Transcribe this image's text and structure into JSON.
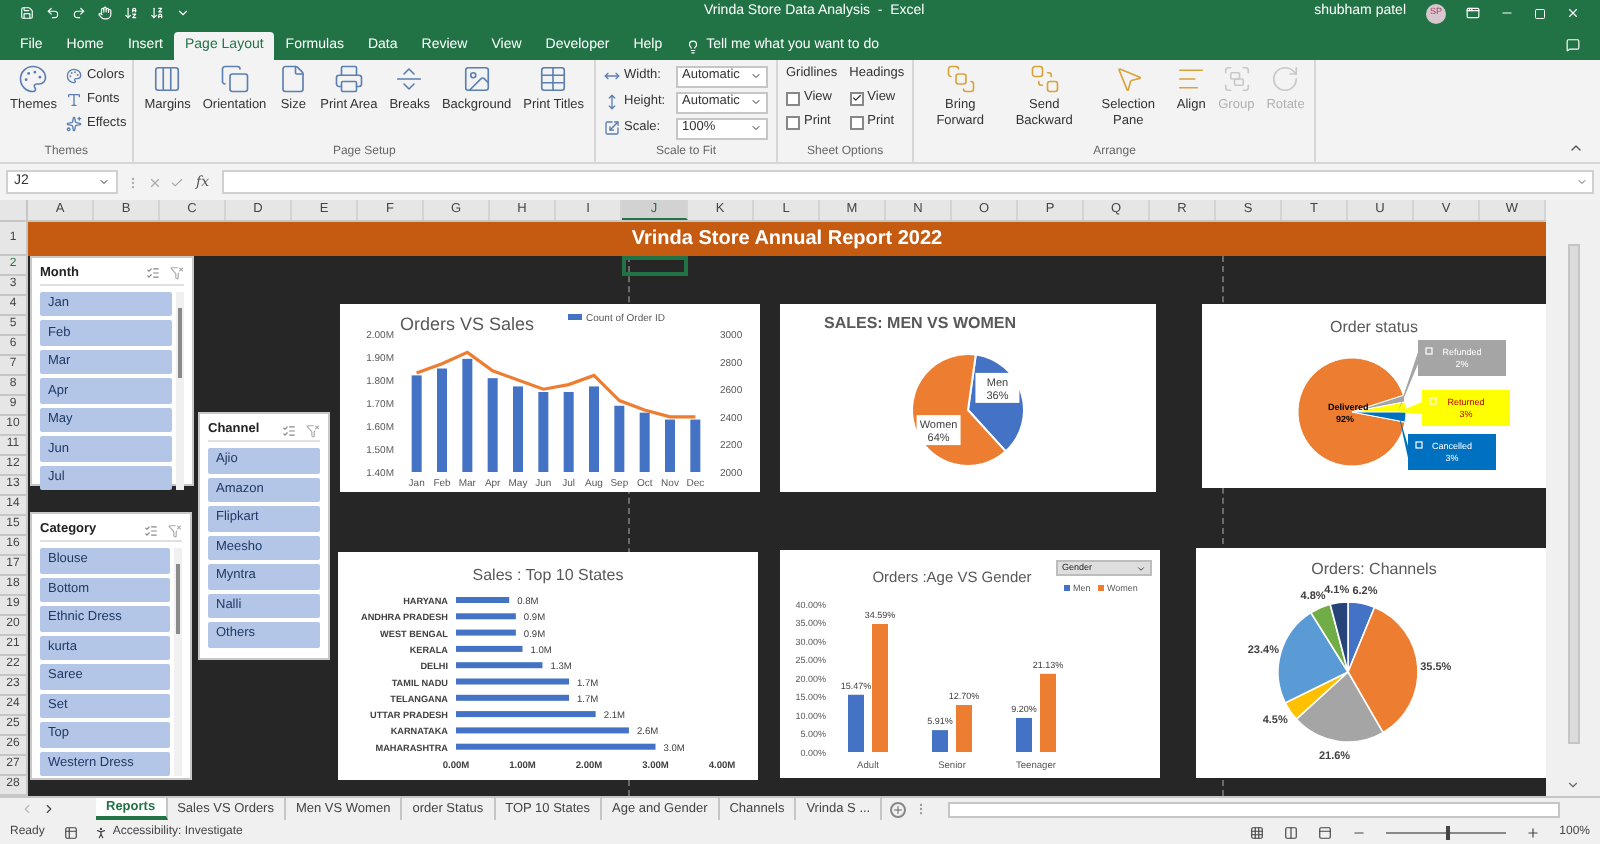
{
  "window": {
    "title": "Vrinda Store Data Analysis  -  Excel",
    "user": "shubham patel",
    "user_initials": "SP"
  },
  "menu_tabs": [
    {
      "label": "File",
      "selected": false
    },
    {
      "label": "Home",
      "selected": false
    },
    {
      "label": "Insert",
      "selected": false
    },
    {
      "label": "Page Layout",
      "selected": true
    },
    {
      "label": "Formulas",
      "selected": false
    },
    {
      "label": "Data",
      "selected": false
    },
    {
      "label": "Review",
      "selected": false
    },
    {
      "label": "View",
      "selected": false
    },
    {
      "label": "Developer",
      "selected": false
    },
    {
      "label": "Help",
      "selected": false
    }
  ],
  "tell_me": "Tell me what you want to do",
  "ribbon": {
    "themes": {
      "label": "Themes",
      "big": "Themes",
      "small": [
        "Colors",
        "Fonts",
        "Effects"
      ]
    },
    "page_setup": {
      "label": "Page Setup",
      "buttons": [
        "Margins",
        "Orientation",
        "Size",
        "Print Area",
        "Breaks",
        "Background",
        "Print Titles"
      ]
    },
    "scale_to_fit": {
      "label": "Scale to Fit",
      "rows": [
        {
          "label": "Width:",
          "value": "Automatic"
        },
        {
          "label": "Height:",
          "value": "Automatic"
        },
        {
          "label": "Scale:",
          "value": "100%"
        }
      ]
    },
    "sheet_options": {
      "label": "Sheet Options",
      "columns": [
        {
          "heading": "Gridlines",
          "options": [
            {
              "label": "View",
              "checked": false
            },
            {
              "label": "Print",
              "checked": false
            }
          ]
        },
        {
          "heading": "Headings",
          "options": [
            {
              "label": "View",
              "checked": true
            },
            {
              "label": "Print",
              "checked": false
            }
          ]
        }
      ]
    },
    "arrange": {
      "label": "Arrange",
      "buttons": [
        {
          "label": "Bring Forward",
          "disabled": false
        },
        {
          "label": "Send Backward",
          "disabled": false
        },
        {
          "label": "Selection Pane",
          "disabled": false
        },
        {
          "label": "Align",
          "disabled": false
        },
        {
          "label": "Group",
          "disabled": true
        },
        {
          "label": "Rotate",
          "disabled": true
        }
      ]
    }
  },
  "formula_bar": {
    "name_box": "J2",
    "function_label": "fx"
  },
  "columns": [
    "A",
    "B",
    "C",
    "D",
    "E",
    "F",
    "G",
    "H",
    "I",
    "J",
    "K",
    "L",
    "M",
    "N",
    "O",
    "P",
    "Q",
    "R",
    "S",
    "T",
    "U",
    "V",
    "W"
  ],
  "rows": [
    "1",
    "2",
    "3",
    "4",
    "5",
    "6",
    "7",
    "8",
    "9",
    "10",
    "11",
    "12",
    "13",
    "14",
    "15",
    "16",
    "17",
    "18",
    "19",
    "20",
    "21",
    "22",
    "23",
    "24",
    "25",
    "26",
    "27",
    "28"
  ],
  "report_title": "Vrinda Store Annual Report 2022",
  "slicers": [
    {
      "title": "Month",
      "items": [
        {
          "label": "Jan",
          "selected": true
        },
        {
          "label": "Feb",
          "selected": true
        },
        {
          "label": "Mar",
          "selected": true
        },
        {
          "label": "Apr",
          "selected": true
        },
        {
          "label": "May",
          "selected": true
        },
        {
          "label": "Jun",
          "selected": true
        },
        {
          "label": "Jul",
          "selected": true
        }
      ]
    },
    {
      "title": "Category",
      "items": [
        {
          "label": "Blouse",
          "selected": true
        },
        {
          "label": "Bottom",
          "selected": true
        },
        {
          "label": "Ethnic Dress",
          "selected": true
        },
        {
          "label": "kurta",
          "selected": true
        },
        {
          "label": "Saree",
          "selected": true
        },
        {
          "label": "Set",
          "selected": true
        },
        {
          "label": "Top",
          "selected": true
        },
        {
          "label": "Western Dress",
          "selected": true
        }
      ]
    },
    {
      "title": "Channel",
      "items": [
        {
          "label": "Ajio",
          "selected": true
        },
        {
          "label": "Amazon",
          "selected": true
        },
        {
          "label": "Flipkart",
          "selected": true
        },
        {
          "label": "Meesho",
          "selected": true
        },
        {
          "label": "Myntra",
          "selected": true
        },
        {
          "label": "Nalli",
          "selected": true
        },
        {
          "label": "Others",
          "selected": true
        }
      ]
    }
  ],
  "charts": [
    {
      "kind": "combo",
      "chart_data": {
        "type": "bar",
        "title": "Orders VS Sales",
        "categories": [
          "Jan",
          "Feb",
          "Mar",
          "Apr",
          "May",
          "Jun",
          "Jul",
          "Aug",
          "Sep",
          "Oct",
          "Nov",
          "Dec"
        ],
        "legend": "top",
        "series": [
          {
            "name": "Count of Order ID",
            "color": "#4472c4",
            "axis": "y2",
            "values": [
              2700,
              2750,
              2820,
              2680,
              2620,
              2580,
              2580,
              2620,
              2480,
              2430,
              2380,
              2380
            ]
          },
          {
            "type": "line",
            "color": "#ed7d31",
            "values": [
              1.83,
              1.87,
              1.92,
              1.84,
              1.8,
              1.76,
              1.78,
              1.82,
              1.71,
              1.67,
              1.64,
              1.64
            ]
          }
        ],
        "ylim": [
          1.4,
          2.0
        ],
        "yticks": [
          {
            "value": 1.4,
            "label": "1.40M"
          },
          {
            "value": 1.5,
            "label": "1.50M"
          },
          {
            "value": 1.6,
            "label": "1.60M"
          },
          {
            "value": 1.7,
            "label": "1.70M"
          },
          {
            "value": 1.8,
            "label": "1.80M"
          },
          {
            "value": 1.9,
            "label": "1.90M"
          },
          {
            "value": 2.0,
            "label": "2.00M"
          }
        ],
        "y2lim": [
          2000,
          3000
        ],
        "y2ticks": [
          2000,
          2200,
          2400,
          2600,
          2800,
          3000
        ]
      }
    },
    {
      "kind": "pie_labeled",
      "chart_data": {
        "type": "pie",
        "title": "SALES: MEN VS WOMEN",
        "categories": [
          "Men",
          "Women"
        ],
        "values": [
          36,
          64
        ],
        "colors": [
          "#4472c4",
          "#ed7d31"
        ],
        "value_labels": [
          "36%",
          "64%"
        ]
      }
    },
    {
      "kind": "pie_callout",
      "chart_data": {
        "type": "pie",
        "title": "Order status",
        "legend": "right",
        "categories": [
          "Delivered",
          "Refunded",
          "Returned",
          "Cancelled"
        ],
        "values": [
          92,
          2,
          3,
          3
        ],
        "colors": [
          "#ed7d31",
          "#a5a5a5",
          "#ffff00",
          "#0070c0"
        ],
        "value_labels": [
          "92%",
          "2%",
          "3%",
          "3%"
        ]
      }
    },
    {
      "kind": "hbar",
      "chart_data": {
        "type": "bar",
        "orientation": "horizontal",
        "title": "Sales : Top 10 States",
        "categories": [
          "HARYANA",
          "ANDHRA PRADESH",
          "WEST BENGAL",
          "KERALA",
          "DELHI",
          "TAMIL NADU",
          "TELANGANA",
          "UTTAR PRADESH",
          "KARNATAKA",
          "MAHARASHTRA"
        ],
        "series": [
          {
            "color": "#4472c4",
            "values": [
              0.8,
              0.9,
              0.9,
              1.0,
              1.3,
              1.7,
              1.7,
              2.1,
              2.6,
              3.0
            ]
          }
        ],
        "value_labels": [
          "0.8M",
          "0.9M",
          "0.9M",
          "1.0M",
          "1.3M",
          "1.7M",
          "1.7M",
          "2.1M",
          "2.6M",
          "3.0M"
        ],
        "xlim": [
          0,
          4
        ],
        "xticks": [
          {
            "value": 0,
            "label": "0.00M"
          },
          {
            "value": 1,
            "label": "1.00M"
          },
          {
            "value": 2,
            "label": "2.00M"
          },
          {
            "value": 3,
            "label": "3.00M"
          },
          {
            "value": 4,
            "label": "4.00M"
          }
        ]
      }
    },
    {
      "kind": "grouped_bar",
      "filter_button": "Gender",
      "chart_data": {
        "type": "bar",
        "title": "Orders :Age VS Gender",
        "legend": "top-right",
        "categories": [
          "Adult",
          "Senior",
          "Teenager"
        ],
        "series": [
          {
            "name": "Men",
            "color": "#4472c4",
            "values": [
              15.47,
              5.91,
              9.2
            ],
            "value_labels": [
              "15.47%",
              "5.91%",
              "9.20%"
            ]
          },
          {
            "name": "Women",
            "color": "#ed7d31",
            "values": [
              34.59,
              12.7,
              21.13
            ],
            "value_labels": [
              "34.59%",
              "12.70%",
              "21.13%"
            ]
          }
        ],
        "ylim": [
          0,
          40
        ],
        "yticks": [
          {
            "value": 0,
            "label": "0.00%"
          },
          {
            "value": 5,
            "label": "5.00%"
          },
          {
            "value": 10,
            "label": "10.00%"
          },
          {
            "value": 15,
            "label": "15.00%"
          },
          {
            "value": 20,
            "label": "20.00%"
          },
          {
            "value": 25,
            "label": "25.00%"
          },
          {
            "value": 30,
            "label": "30.00%"
          },
          {
            "value": 35,
            "label": "35.00%"
          },
          {
            "value": 40,
            "label": "40.00%"
          }
        ]
      }
    },
    {
      "kind": "pie_plain",
      "chart_data": {
        "type": "pie",
        "title": "Orders: Channels",
        "values": [
          6.2,
          35.5,
          21.6,
          4.5,
          23.4,
          4.8,
          4.1
        ],
        "colors": [
          "#4472c4",
          "#ed7d31",
          "#a5a5a5",
          "#ffc000",
          "#5b9bd5",
          "#70ad47",
          "#264478"
        ],
        "value_labels": [
          "6.2%",
          "35.5%",
          "21.6%",
          "4.5%",
          "23.4%",
          "4.8%",
          "4.1%"
        ]
      }
    }
  ],
  "sheet_tabs": [
    {
      "label": "Reports",
      "selected": true
    },
    {
      "label": "Sales VS Orders",
      "selected": false
    },
    {
      "label": "Men VS Women",
      "selected": false
    },
    {
      "label": "order Status",
      "selected": false
    },
    {
      "label": "TOP 10 States",
      "selected": false
    },
    {
      "label": "Age and Gender",
      "selected": false
    },
    {
      "label": "Channels",
      "selected": false
    },
    {
      "label": "Vrinda S ...",
      "selected": false
    }
  ],
  "status_bar": {
    "status": "Ready",
    "accessibility": "Accessibility: Investigate",
    "zoom": "100%",
    "zoom_slider": {
      "level": 0.5
    }
  }
}
